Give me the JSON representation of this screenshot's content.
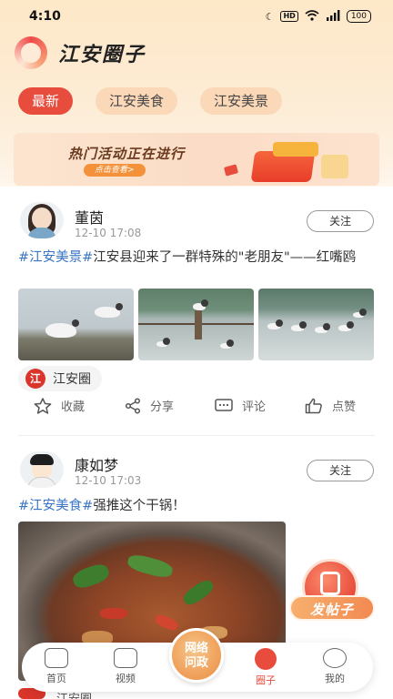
{
  "status_bar": {
    "time": "4:10",
    "hd": "HD",
    "battery": "100"
  },
  "app": {
    "title": "江安圈子"
  },
  "tabs": [
    {
      "label": "最新",
      "active": true
    },
    {
      "label": "江安美食",
      "active": false
    },
    {
      "label": "江安美景",
      "active": false
    }
  ],
  "banner": {
    "title": "热门活动正在进行",
    "cta": "点击查看>"
  },
  "posts": [
    {
      "username": "董茵",
      "time": "12-10 17:08",
      "follow_label": "关注",
      "tag": "#江安美景#",
      "text": "江安县迎来了一群特殊的\"老朋友\"——红嘴鸥",
      "circle": "江安圈",
      "actions": {
        "favorite": "收藏",
        "share": "分享",
        "comment": "评论",
        "like": "点赞"
      }
    },
    {
      "username": "康如梦",
      "time": "12-10 17:03",
      "follow_label": "关注",
      "tag": "#江安美食#",
      "text": "强推这个干锅！",
      "circle": "江安圈"
    }
  ],
  "fab": {
    "label": "发帖子"
  },
  "bottom_nav": {
    "items": [
      {
        "label": "首页",
        "icon": "home-icon"
      },
      {
        "label": "视频",
        "icon": "video-icon"
      },
      {
        "label": "圈子",
        "icon": "circle-icon",
        "active": true
      },
      {
        "label": "我的",
        "icon": "profile-icon"
      }
    ],
    "center_label_line1": "网络",
    "center_label_line2": "问政"
  },
  "colors": {
    "accent": "#e84c3d",
    "tag_blue": "#3a75c4",
    "tab_bg": "#fbd8b8"
  }
}
